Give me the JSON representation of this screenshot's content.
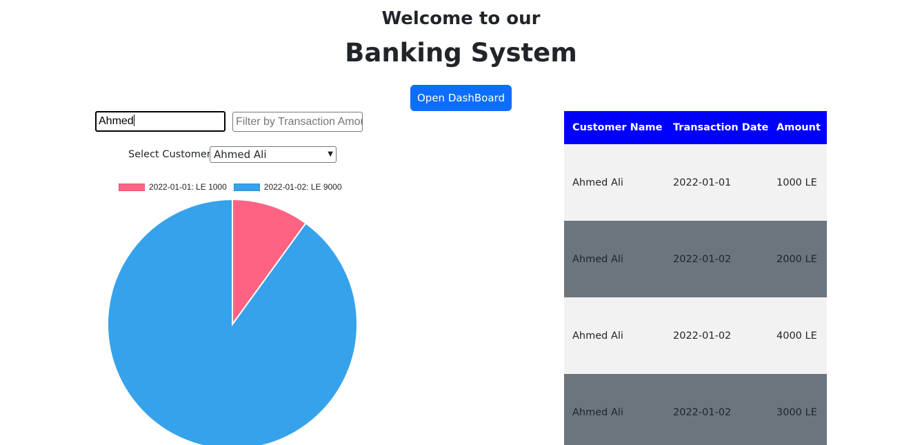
{
  "header": {
    "welcome": "Welcome to our",
    "title": "Banking System",
    "dashboard_button": "Open DashBoard"
  },
  "filters": {
    "name_value": "Ahmed",
    "amount_placeholder": "Filter by Transaction Amount",
    "select_label": "Select Customer:",
    "selected_customer": "Ahmed Ali"
  },
  "chart_data": {
    "type": "pie",
    "categories": [
      "2022-01-01: LE 1000",
      "2022-01-02: LE 9000"
    ],
    "values": [
      1000,
      9000
    ],
    "colors": [
      "#ff6384",
      "#36a2eb"
    ],
    "legend": "top"
  },
  "table": {
    "headers": [
      "Customer Name",
      "Transaction Date",
      "Amount"
    ],
    "rows": [
      [
        "Ahmed Ali",
        "2022-01-01",
        "1000 LE"
      ],
      [
        "Ahmed Ali",
        "2022-01-02",
        "2000 LE"
      ],
      [
        "Ahmed Ali",
        "2022-01-02",
        "4000 LE"
      ],
      [
        "Ahmed Ali",
        "2022-01-02",
        "3000 LE"
      ]
    ],
    "colors": {
      "header_bg": "#0000ff",
      "row_light": "#f2f2f2",
      "row_dark": "#6c757d"
    }
  },
  "colors": {
    "accent": "#0d6efd"
  }
}
